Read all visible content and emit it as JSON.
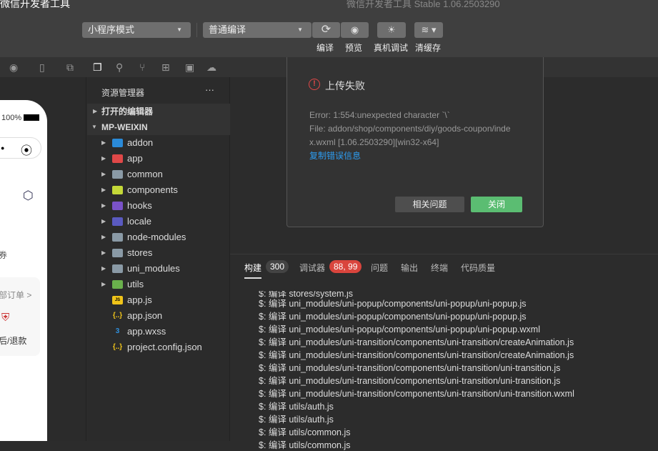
{
  "window": {
    "app_title": "微信开发者工具",
    "title": "微信开发者工具 Stable 1.06.2503290"
  },
  "toolbar": {
    "mode": "小程序模式",
    "compile_mode": "普通编译",
    "compile": "编译",
    "preview": "预览",
    "remote_debug": "真机调试",
    "clear_cache": "清缓存"
  },
  "simulator": {
    "battery": "100%",
    "coupon_text": "券",
    "orders_text": "部订单 >",
    "refund_text": "后/退款"
  },
  "explorer": {
    "title": "资源管理器",
    "more": "···",
    "open_editors": "打开的编辑器",
    "project": "MP-WEIXIN",
    "items": [
      {
        "name": "addon",
        "type": "folder",
        "color": "#2a8ad8"
      },
      {
        "name": "app",
        "type": "folder",
        "color": "#e04848"
      },
      {
        "name": "common",
        "type": "folder",
        "color": "#8a9aa6"
      },
      {
        "name": "components",
        "type": "folder",
        "color": "#c4d838"
      },
      {
        "name": "hooks",
        "type": "folder",
        "color": "#7a52c8"
      },
      {
        "name": "locale",
        "type": "folder",
        "color": "#5a5ac0"
      },
      {
        "name": "node-modules",
        "type": "folder",
        "color": "#8a9aa6"
      },
      {
        "name": "stores",
        "type": "folder",
        "color": "#8a9aa6"
      },
      {
        "name": "uni_modules",
        "type": "folder",
        "color": "#8a9aa6"
      },
      {
        "name": "utils",
        "type": "folder",
        "color": "#6ab04c"
      },
      {
        "name": "app.js",
        "type": "js",
        "color": "#f0c419"
      },
      {
        "name": "app.json",
        "type": "json",
        "color": "#f0c419"
      },
      {
        "name": "app.wxss",
        "type": "css",
        "color": "#2f8fdc"
      },
      {
        "name": "project.config.json",
        "type": "json",
        "color": "#f0c419"
      }
    ]
  },
  "dialog": {
    "title": "上传失败",
    "error": "Error: 1:554:unexpected character `\\`",
    "file_line1": "File: addon/shop/components/diy/goods-coupon/inde",
    "file_line2": "x.wxml [1.06.2503290][win32-x64]",
    "copy_link": "复制错误信息",
    "related_button": "相关问题",
    "close_button": "关闭",
    "accent": "#5bbd72"
  },
  "console": {
    "tabs": [
      {
        "label": "构建",
        "badge": "300"
      },
      {
        "label": "调试器",
        "badge": "88, 99"
      },
      {
        "label": "问题"
      },
      {
        "label": "输出"
      },
      {
        "label": "终端"
      },
      {
        "label": "代码质量"
      }
    ],
    "lines": [
      "$: 编译 stores/system.js",
      "$: 编译 uni_modules/uni-popup/components/uni-popup/uni-popup.js",
      "$: 编译 uni_modules/uni-popup/components/uni-popup/uni-popup.js",
      "$: 编译 uni_modules/uni-popup/components/uni-popup/uni-popup.wxml",
      "$: 编译 uni_modules/uni-transition/components/uni-transition/createAnimation.js",
      "$: 编译 uni_modules/uni-transition/components/uni-transition/createAnimation.js",
      "$: 编译 uni_modules/uni-transition/components/uni-transition/uni-transition.js",
      "$: 编译 uni_modules/uni-transition/components/uni-transition/uni-transition.js",
      "$: 编译 uni_modules/uni-transition/components/uni-transition/uni-transition.wxml",
      "$: 编译 utils/auth.js",
      "$: 编译 utils/auth.js",
      "$: 编译 utils/common.js",
      "$: 编译 utils/common.js"
    ]
  }
}
